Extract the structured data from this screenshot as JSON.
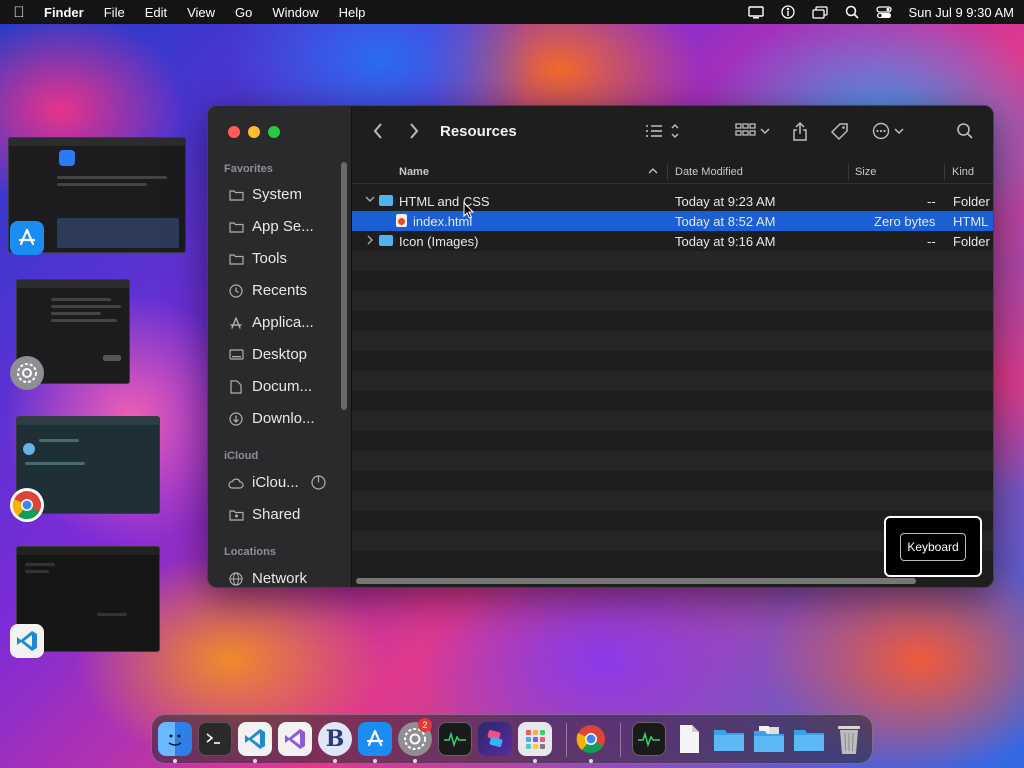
{
  "menubar": {
    "app_name": "Finder",
    "items": [
      "File",
      "Edit",
      "View",
      "Go",
      "Window",
      "Help"
    ],
    "clock": "Sun Jul 9  9:30 AM"
  },
  "finder": {
    "folder_title": "Resources",
    "sidebar": {
      "favorites_label": "Favorites",
      "favorites": [
        "System",
        "App Se...",
        "Tools",
        "Recents",
        "Applica...",
        "Desktop",
        "Docum...",
        "Downlo..."
      ],
      "icloud_label": "iCloud",
      "icloud": [
        "iClou...",
        "Shared"
      ],
      "locations_label": "Locations",
      "locations": [
        "Network"
      ]
    },
    "columns": {
      "name": "Name",
      "date": "Date Modified",
      "size": "Size",
      "kind": "Kind"
    },
    "rows": [
      {
        "name": "HTML and CSS",
        "date": "Today at 9:23 AM",
        "size": "--",
        "kind": "Folder"
      },
      {
        "name": "index.html",
        "date": "Today at 8:52 AM",
        "size": "Zero bytes",
        "kind": "HTML"
      },
      {
        "name": "Icon (Images)",
        "date": "Today at 9:16 AM",
        "size": "--",
        "kind": "Folder"
      }
    ]
  },
  "overlay": {
    "keyboard_label": "Keyboard"
  },
  "dock": {
    "badge_count": "2",
    "apps": [
      "finder-icon",
      "terminal-icon",
      "vscode-icon",
      "visual-studio-icon",
      "bbedit-icon",
      "app-store-icon",
      "system-settings-icon",
      "activity-monitor-icon",
      "shortcuts-icon",
      "launchpad-icon",
      "chrome-icon",
      "activity-monitor-small-icon",
      "document-icon",
      "folder-icon",
      "folder-icon",
      "folder-icon",
      "trash-icon"
    ]
  },
  "colors": {
    "selection": "#1a5fd4",
    "folder": "#4fb3f0",
    "close": "#ff5f57",
    "minimize": "#febc2e",
    "zoom": "#28c840"
  }
}
